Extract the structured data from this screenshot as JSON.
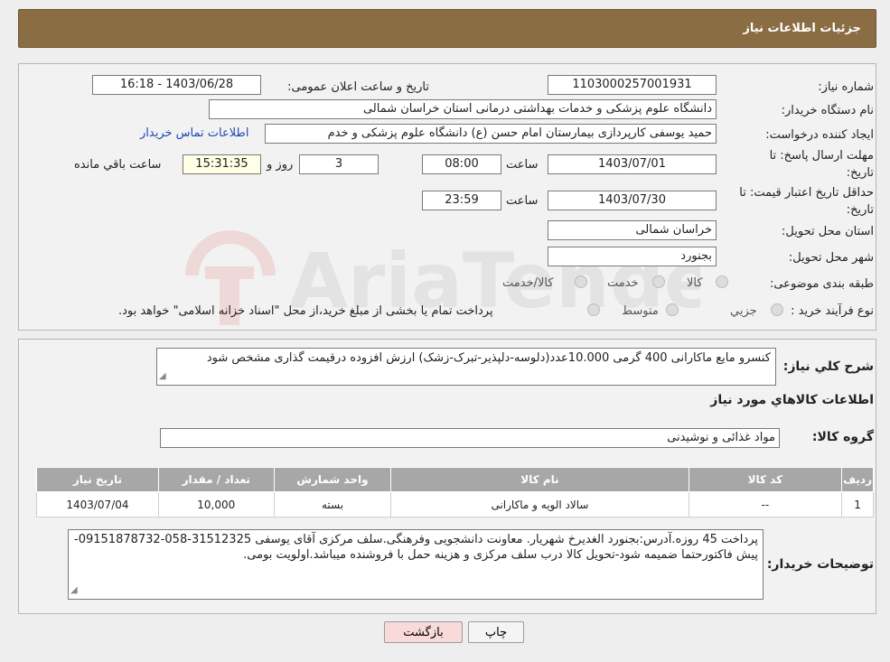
{
  "header": {
    "title": "جزئیات اطلاعات نیاز"
  },
  "form": {
    "need_number_label": "شماره نیاز:",
    "need_number": "1103000257001931",
    "announce_label": "تاریخ و ساعت اعلان عمومی:",
    "announce_value": "1403/06/28 - 16:18",
    "buyer_org_label": "نام دستگاه خریدار:",
    "buyer_org": "دانشگاه علوم پزشکی و خدمات بهداشتی درمانی استان خراسان شمالی",
    "creator_label": "ایجاد کننده درخواست:",
    "creator": "حمید یوسفی کارپردازی بیمارستان امام حسن (ع) دانشگاه علوم پزشکی و خدم",
    "contact_link": "اطلاعات تماس خریدار",
    "deadline_label_1": "مهلت ارسال پاسخ: تا",
    "deadline_label_2": "تاریخ:",
    "deadline_date": "1403/07/01",
    "time_label": "ساعت",
    "deadline_time": "08:00",
    "days_value": "3",
    "days_label": "روز و",
    "remaining_time": "15:31:35",
    "remaining_label": "ساعت باقي مانده",
    "validity_label_1": "حداقل تاریخ اعتبار قیمت: تا",
    "validity_label_2": "تاریخ:",
    "validity_date": "1403/07/30",
    "validity_time": "23:59",
    "province_label": "استان محل تحویل:",
    "province": "خراسان شمالی",
    "city_label": "شهر محل تحویل:",
    "city": "بجنورد",
    "category_label": "طبقه بندی موضوعی:",
    "category_options": [
      "کالا",
      "خدمت",
      "کالا/خدمت"
    ],
    "process_label": "نوع فرآیند خرید :",
    "process_options": [
      "جزیي",
      "متوسط"
    ],
    "process_note": "پرداخت تمام یا بخشی از مبلغ خرید،از محل \"اسناد خزانه اسلامی\" خواهد بود."
  },
  "summary": {
    "label": "شرح کلي نياز:",
    "text": "کنسرو مایع ماکارانی 400 گرمی 10.000عدد(دلوسه-دلپذیر-تبرک-زشک) ارزش افزوده درقیمت گذاری مشخص شود",
    "items_title": "اطلاعات کالاهاي مورد نياز",
    "group_label": "گروه کالا:",
    "group_value": "مواد غذائی و نوشیدنی"
  },
  "table": {
    "headers": [
      "رديف",
      "کد کالا",
      "نام کالا",
      "واحد شمارش",
      "تعداد / مقدار",
      "تاريخ نياز"
    ],
    "rows": [
      [
        "1",
        "--",
        "سالاد الویه و ماکارانی",
        "بسته",
        "10,000",
        "1403/07/04"
      ]
    ]
  },
  "buyer_notes": {
    "label": "توضیحات خریدار:",
    "text": "پرداخت 45 روزه.آدرس:بجنورد الغدیرخ شهریار. معاونت دانشجویی وفرهنگی.سلف مرکزی آقای یوسفی 31512325-058-09151878732-پیش فاکتورحتما ضمیمه شود-تحویل کالا درب سلف مرکزی و هزینه حمل با فروشنده میباشد.اولویت بومی."
  },
  "buttons": {
    "print": "چاپ",
    "back": "بازگشت"
  },
  "watermark": {
    "text": "AriaTender.neT"
  },
  "colors": {
    "header": "#8b6d44",
    "link": "#1d49b5",
    "table_header": "#a7a7a7",
    "back_button": "#f8dada"
  }
}
